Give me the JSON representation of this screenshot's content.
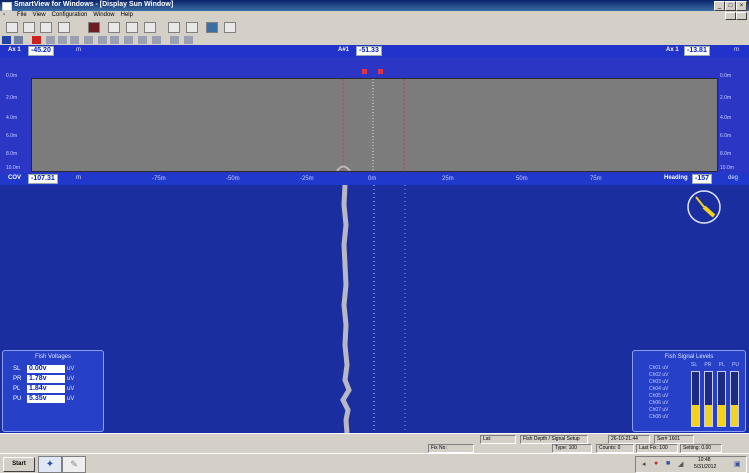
{
  "window": {
    "title": "SmartView for Windows - [Display Sun Window]",
    "controls": [
      "_",
      "□",
      "×"
    ]
  },
  "menu": [
    "File",
    "View",
    "Configuration",
    "Window",
    "Help"
  ],
  "readouts": {
    "left_label": "Ax 1",
    "left_value": "-45.20",
    "left_unit": "m",
    "center_label": "A#1",
    "center_value": "-51.33",
    "right_label": "Ax 1",
    "right_value": "-13.81",
    "right_unit": "m"
  },
  "trace": {
    "y_ticks": [
      "0.0m",
      "2.0m",
      "4.0m",
      "6.0m",
      "8.0m",
      "10.0m"
    ],
    "x_ticks": [
      "-75m",
      "-50m",
      "-25m",
      "0m",
      "25m",
      "50m",
      "75m"
    ]
  },
  "waterfall": {
    "cov_label": "COV",
    "cov_value": "-107.31",
    "cov_unit": "m",
    "heading_label": "Heading",
    "heading_value": "-157",
    "heading_unit": "deg"
  },
  "left_panel": {
    "title": "Fish Voltages",
    "rows": [
      {
        "label": "SL",
        "value": "0.00v",
        "unit": "uV"
      },
      {
        "label": "PR",
        "value": "1.78v",
        "unit": "uV"
      },
      {
        "label": "PL",
        "value": "1.84v",
        "unit": "uV"
      },
      {
        "label": "PU",
        "value": "5.35v",
        "unit": "uV"
      }
    ]
  },
  "right_panel": {
    "title": "Fish Signal Levels",
    "row_labels": [
      "Ch01 uV",
      "Ch02 uV",
      "Ch03 uV",
      "Ch04 uV",
      "Ch05 uV",
      "Ch06 uV",
      "Ch07 uV",
      "Ch08 uV"
    ],
    "bar_labels": [
      "SL",
      "PR",
      "PL",
      "PU"
    ],
    "bar_levels": [
      0.38,
      0.38,
      0.38,
      0.38
    ],
    "bar_color": "#f2d21b"
  },
  "status": {
    "f1": "Lat:",
    "f2": "Fish Depth / Signal Setup",
    "f3": "26-10-21.44",
    "f4": "Ser# 1601",
    "f5": "Fix No:",
    "f6": "Type: 100",
    "f7": "Counts: 0",
    "f8": "Last Fix: 100",
    "f9": "Setting: 0.00"
  },
  "taskbar": {
    "start_label": "Start",
    "time": "10:48",
    "date": "5/31/2012"
  },
  "colors": {
    "accent": "#2233cc",
    "trace_bg": "#7c7c7c",
    "cursor": "#dd3344"
  }
}
